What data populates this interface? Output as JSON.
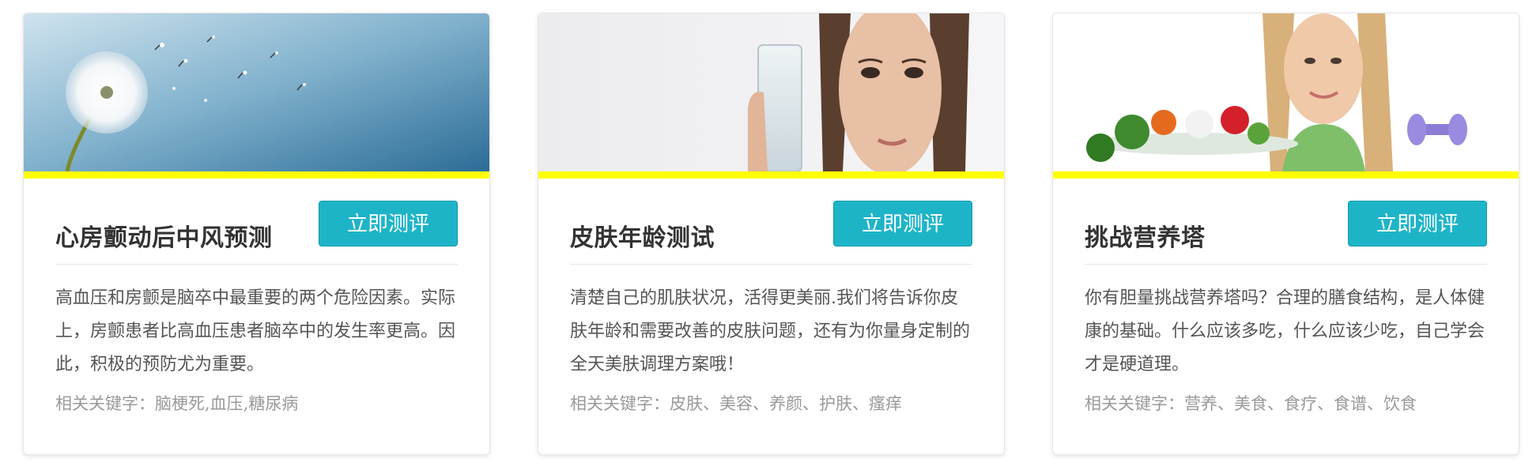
{
  "cards": [
    {
      "title": "心房颤动后中风预测",
      "button_label": "立即测评",
      "description": "高血压和房颤是脑卒中最重要的两个危险因素。实际上，房颤患者比高血压患者脑卒中的发生率更高。因此，积极的预防尤为重要。",
      "keywords_label": "相关关键字：",
      "keywords": "脑梗死,血压,糖尿病",
      "image": "dandelion-on-blue-sky"
    },
    {
      "title": "皮肤年龄测试",
      "button_label": "立即测评",
      "description": "清楚自己的肌肤状况，活得更美丽.我们将告诉你皮肤年龄和需要改善的皮肤问题，还有为你量身定制的全天美肤调理方案哦！",
      "keywords_label": "相关关键字：",
      "keywords": "皮肤、美容、养颜、护肤、瘙痒",
      "image": "woman-holding-glass-of-water"
    },
    {
      "title": "挑战营养塔",
      "button_label": "立即测评",
      "description": "你有胆量挑战营养塔吗？合理的膳食结构，是人体健康的基础。什么应该多吃，什么应该少吃，自己学会才是硬道理。",
      "keywords_label": "相关关键字：",
      "keywords": "营养、美食、食疗、食谱、饮食",
      "image": "woman-with-vegetables-and-dumbbell"
    }
  ],
  "colors": {
    "accent_bar": "#ffff00",
    "button": "#1eb4c8",
    "title": "#333333",
    "body_text": "#555555",
    "keyword_text": "#999999"
  }
}
